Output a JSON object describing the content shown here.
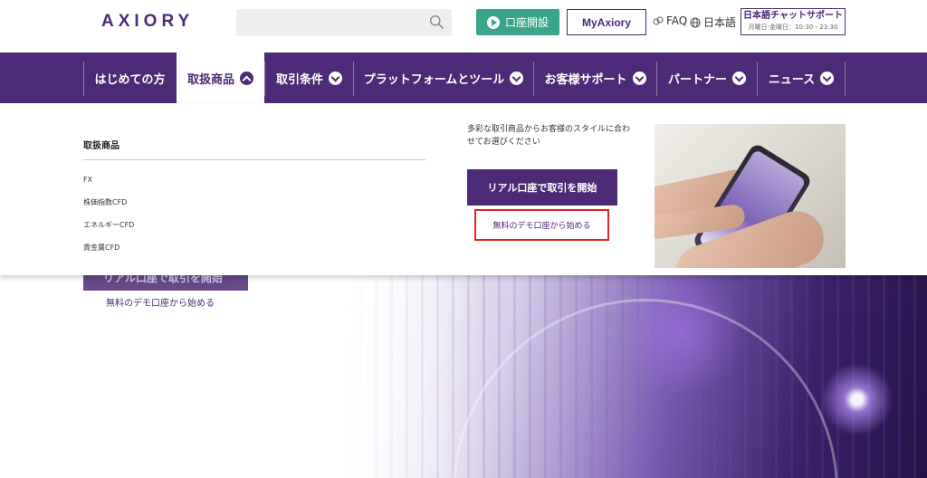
{
  "header": {
    "logo": "AXIORY",
    "search_placeholder": "",
    "open_account": "口座開設",
    "my_axiory": "MyAxiory",
    "faq": "FAQ",
    "language": "日本語",
    "chat_title": "日本語チャットサポート",
    "chat_hours": "月曜日-金曜日：10:30 - 23:30"
  },
  "nav": {
    "items": [
      {
        "label": "はじめての方"
      },
      {
        "label": "取扱商品"
      },
      {
        "label": "取引条件"
      },
      {
        "label": "プラットフォームとツール"
      },
      {
        "label": "お客様サポート"
      },
      {
        "label": "パートナー"
      },
      {
        "label": "ニュース"
      }
    ],
    "active_index": 1
  },
  "dropdown": {
    "heading": "取扱商品",
    "products": [
      "FX",
      "株価指数CFD",
      "エネルギーCFD",
      "貴金属CFD"
    ],
    "promo_text": "多彩な取引商品からお客様のスタイルに合わせてお選びください",
    "real_button": "リアル口座で取引を開始",
    "demo_link": "無料のデモ口座から始める"
  },
  "hero": {
    "button": "リアル口座で取引を開始",
    "demo_link": "無料のデモ口座から始める"
  },
  "colors": {
    "brand_purple": "#4d2a75",
    "green": "#3aa58a",
    "highlight_red": "#e0281f"
  }
}
